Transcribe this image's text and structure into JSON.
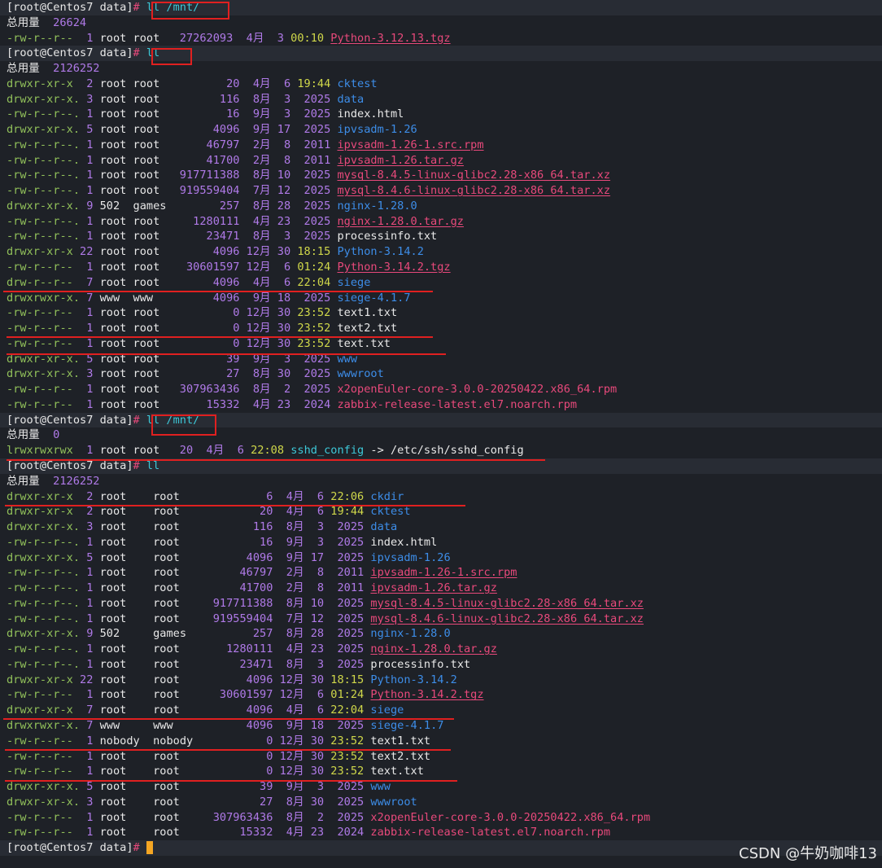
{
  "terminal": {
    "prompt": "[root@Centos7 data]",
    "hash": "#",
    "total_label": "总用量",
    "blocks": [
      {
        "cmd": "ll /mnt/",
        "total": "26624",
        "rows": [
          {
            "perm": "-rw-r--r--",
            "links": "1",
            "owner": "root",
            "group": "root",
            "size": "27262093",
            "month": "4月",
            "day": "3",
            "time": "00:10",
            "name": "Python-3.12.13.tgz",
            "type": "arch"
          }
        ]
      },
      {
        "cmd": "ll",
        "total": "2126252",
        "rows": [
          {
            "perm": "drwxr-xr-x",
            "links": "2",
            "owner": "root",
            "group": "root",
            "size": "20",
            "month": "4月",
            "day": "6",
            "time": "19:44",
            "name": "cktest",
            "type": "dir"
          },
          {
            "perm": "drwxr-xr-x.",
            "links": "3",
            "owner": "root",
            "group": "root",
            "size": "116",
            "month": "8月",
            "day": "3",
            "time": "2025",
            "name": "data",
            "type": "dir"
          },
          {
            "perm": "-rw-r--r--.",
            "links": "1",
            "owner": "root",
            "group": "root",
            "size": "16",
            "month": "9月",
            "day": "3",
            "time": "2025",
            "name": "index.html",
            "type": "file"
          },
          {
            "perm": "drwxr-xr-x.",
            "links": "5",
            "owner": "root",
            "group": "root",
            "size": "4096",
            "month": "9月",
            "day": "17",
            "time": "2025",
            "name": "ipvsadm-1.26",
            "type": "dir"
          },
          {
            "perm": "-rw-r--r--.",
            "links": "1",
            "owner": "root",
            "group": "root",
            "size": "46797",
            "month": "2月",
            "day": "8",
            "time": "2011",
            "name": "ipvsadm-1.26-1.src.rpm",
            "type": "rpm"
          },
          {
            "perm": "-rw-r--r--.",
            "links": "1",
            "owner": "root",
            "group": "root",
            "size": "41700",
            "month": "2月",
            "day": "8",
            "time": "2011",
            "name": "ipvsadm-1.26.tar.gz",
            "type": "arch"
          },
          {
            "perm": "-rw-r--r--.",
            "links": "1",
            "owner": "root",
            "group": "root",
            "size": "917711388",
            "month": "8月",
            "day": "10",
            "time": "2025",
            "name": "mysql-8.4.5-linux-glibc2.28-x86_64.tar.xz",
            "type": "arch"
          },
          {
            "perm": "-rw-r--r--.",
            "links": "1",
            "owner": "root",
            "group": "root",
            "size": "919559404",
            "month": "7月",
            "day": "12",
            "time": "2025",
            "name": "mysql-8.4.6-linux-glibc2.28-x86_64.tar.xz",
            "type": "arch"
          },
          {
            "perm": "drwxr-xr-x.",
            "links": "9",
            "owner": "502",
            "group": "games",
            "size": "257",
            "month": "8月",
            "day": "28",
            "time": "2025",
            "name": "nginx-1.28.0",
            "type": "dir"
          },
          {
            "perm": "-rw-r--r--.",
            "links": "1",
            "owner": "root",
            "group": "root",
            "size": "1280111",
            "month": "4月",
            "day": "23",
            "time": "2025",
            "name": "nginx-1.28.0.tar.gz",
            "type": "arch"
          },
          {
            "perm": "-rw-r--r--.",
            "links": "1",
            "owner": "root",
            "group": "root",
            "size": "23471",
            "month": "8月",
            "day": "3",
            "time": "2025",
            "name": "processinfo.txt",
            "type": "file"
          },
          {
            "perm": "drwxr-xr-x",
            "links": "22",
            "owner": "root",
            "group": "root",
            "size": "4096",
            "month": "12月",
            "day": "30",
            "time": "18:15",
            "name": "Python-3.14.2",
            "type": "dir"
          },
          {
            "perm": "-rw-r--r--",
            "links": "1",
            "owner": "root",
            "group": "root",
            "size": "30601597",
            "month": "12月",
            "day": "6",
            "time": "01:24",
            "name": "Python-3.14.2.tgz",
            "type": "arch"
          },
          {
            "perm": "drw-r--r--",
            "links": "7",
            "owner": "root",
            "group": "root",
            "size": "4096",
            "month": "4月",
            "day": "6",
            "time": "22:04",
            "name": "siege",
            "type": "dir"
          },
          {
            "perm": "drwxrwxr-x.",
            "links": "7",
            "owner": "www",
            "group": "www",
            "size": "4096",
            "month": "9月",
            "day": "18",
            "time": "2025",
            "name": "siege-4.1.7",
            "type": "dir"
          },
          {
            "perm": "-rw-r--r--",
            "links": "1",
            "owner": "root",
            "group": "root",
            "size": "0",
            "month": "12月",
            "day": "30",
            "time": "23:52",
            "name": "text1.txt",
            "type": "file"
          },
          {
            "perm": "-rw-r--r--",
            "links": "1",
            "owner": "root",
            "group": "root",
            "size": "0",
            "month": "12月",
            "day": "30",
            "time": "23:52",
            "name": "text2.txt",
            "type": "file"
          },
          {
            "perm": "-rw-r--r--",
            "links": "1",
            "owner": "root",
            "group": "root",
            "size": "0",
            "month": "12月",
            "day": "30",
            "time": "23:52",
            "name": "text.txt",
            "type": "file"
          },
          {
            "perm": "drwxr-xr-x.",
            "links": "5",
            "owner": "root",
            "group": "root",
            "size": "39",
            "month": "9月",
            "day": "3",
            "time": "2025",
            "name": "www",
            "type": "dir"
          },
          {
            "perm": "drwxr-xr-x.",
            "links": "3",
            "owner": "root",
            "group": "root",
            "size": "27",
            "month": "8月",
            "day": "30",
            "time": "2025",
            "name": "wwwroot",
            "type": "dir"
          },
          {
            "perm": "-rw-r--r--",
            "links": "1",
            "owner": "root",
            "group": "root",
            "size": "307963436",
            "month": "8月",
            "day": "2",
            "time": "2025",
            "name": "x2openEuler-core-3.0.0-20250422.x86_64.rpm",
            "type": "rpm"
          },
          {
            "perm": "-rw-r--r--",
            "links": "1",
            "owner": "root",
            "group": "root",
            "size": "15332",
            "month": "4月",
            "day": "23",
            "time": "2024",
            "name": "zabbix-release-latest.el7.noarch.rpm",
            "type": "rpm"
          }
        ]
      },
      {
        "cmd": "ll /mnt/",
        "total": "0",
        "rows": [
          {
            "perm": "lrwxrwxrwx",
            "links": "1",
            "owner": "root",
            "group": "root",
            "size": "20",
            "month": "4月",
            "day": "6",
            "time": "22:08",
            "name": "sshd_config",
            "type": "link",
            "target": "/etc/ssh/sshd_config"
          }
        ]
      },
      {
        "cmd": "ll",
        "total": "2126252",
        "rows": [
          {
            "perm": "drwxr-xr-x",
            "links": "2",
            "owner": "root",
            "group": "root",
            "size": "6",
            "month": "4月",
            "day": "6",
            "time": "22:06",
            "name": "ckdir",
            "type": "dir"
          },
          {
            "perm": "drwxr-xr-x",
            "links": "2",
            "owner": "root",
            "group": "root",
            "size": "20",
            "month": "4月",
            "day": "6",
            "time": "19:44",
            "name": "cktest",
            "type": "dir"
          },
          {
            "perm": "drwxr-xr-x.",
            "links": "3",
            "owner": "root",
            "group": "root",
            "size": "116",
            "month": "8月",
            "day": "3",
            "time": "2025",
            "name": "data",
            "type": "dir"
          },
          {
            "perm": "-rw-r--r--.",
            "links": "1",
            "owner": "root",
            "group": "root",
            "size": "16",
            "month": "9月",
            "day": "3",
            "time": "2025",
            "name": "index.html",
            "type": "file"
          },
          {
            "perm": "drwxr-xr-x.",
            "links": "5",
            "owner": "root",
            "group": "root",
            "size": "4096",
            "month": "9月",
            "day": "17",
            "time": "2025",
            "name": "ipvsadm-1.26",
            "type": "dir"
          },
          {
            "perm": "-rw-r--r--.",
            "links": "1",
            "owner": "root",
            "group": "root",
            "size": "46797",
            "month": "2月",
            "day": "8",
            "time": "2011",
            "name": "ipvsadm-1.26-1.src.rpm",
            "type": "rpm"
          },
          {
            "perm": "-rw-r--r--.",
            "links": "1",
            "owner": "root",
            "group": "root",
            "size": "41700",
            "month": "2月",
            "day": "8",
            "time": "2011",
            "name": "ipvsadm-1.26.tar.gz",
            "type": "arch"
          },
          {
            "perm": "-rw-r--r--.",
            "links": "1",
            "owner": "root",
            "group": "root",
            "size": "917711388",
            "month": "8月",
            "day": "10",
            "time": "2025",
            "name": "mysql-8.4.5-linux-glibc2.28-x86_64.tar.xz",
            "type": "arch"
          },
          {
            "perm": "-rw-r--r--.",
            "links": "1",
            "owner": "root",
            "group": "root",
            "size": "919559404",
            "month": "7月",
            "day": "12",
            "time": "2025",
            "name": "mysql-8.4.6-linux-glibc2.28-x86_64.tar.xz",
            "type": "arch"
          },
          {
            "perm": "drwxr-xr-x.",
            "links": "9",
            "owner": "502",
            "group": "games",
            "size": "257",
            "month": "8月",
            "day": "28",
            "time": "2025",
            "name": "nginx-1.28.0",
            "type": "dir"
          },
          {
            "perm": "-rw-r--r--.",
            "links": "1",
            "owner": "root",
            "group": "root",
            "size": "1280111",
            "month": "4月",
            "day": "23",
            "time": "2025",
            "name": "nginx-1.28.0.tar.gz",
            "type": "arch"
          },
          {
            "perm": "-rw-r--r--.",
            "links": "1",
            "owner": "root",
            "group": "root",
            "size": "23471",
            "month": "8月",
            "day": "3",
            "time": "2025",
            "name": "processinfo.txt",
            "type": "file"
          },
          {
            "perm": "drwxr-xr-x",
            "links": "22",
            "owner": "root",
            "group": "root",
            "size": "4096",
            "month": "12月",
            "day": "30",
            "time": "18:15",
            "name": "Python-3.14.2",
            "type": "dir"
          },
          {
            "perm": "-rw-r--r--",
            "links": "1",
            "owner": "root",
            "group": "root",
            "size": "30601597",
            "month": "12月",
            "day": "6",
            "time": "01:24",
            "name": "Python-3.14.2.tgz",
            "type": "arch"
          },
          {
            "perm": "drwxr-xr-x",
            "links": "7",
            "owner": "root",
            "group": "root",
            "size": "4096",
            "month": "4月",
            "day": "6",
            "time": "22:04",
            "name": "siege",
            "type": "dir"
          },
          {
            "perm": "drwxrwxr-x.",
            "links": "7",
            "owner": "www",
            "group": "www",
            "size": "4096",
            "month": "9月",
            "day": "18",
            "time": "2025",
            "name": "siege-4.1.7",
            "type": "dir"
          },
          {
            "perm": "-rw-r--r--",
            "links": "1",
            "owner": "nobody",
            "group": "nobody",
            "size": "0",
            "month": "12月",
            "day": "30",
            "time": "23:52",
            "name": "text1.txt",
            "type": "file"
          },
          {
            "perm": "-rw-r--r--",
            "links": "1",
            "owner": "root",
            "group": "root",
            "size": "0",
            "month": "12月",
            "day": "30",
            "time": "23:52",
            "name": "text2.txt",
            "type": "file"
          },
          {
            "perm": "-rw-r--r--",
            "links": "1",
            "owner": "root",
            "group": "root",
            "size": "0",
            "month": "12月",
            "day": "30",
            "time": "23:52",
            "name": "text.txt",
            "type": "file"
          },
          {
            "perm": "drwxr-xr-x.",
            "links": "5",
            "owner": "root",
            "group": "root",
            "size": "39",
            "month": "9月",
            "day": "3",
            "time": "2025",
            "name": "www",
            "type": "dir"
          },
          {
            "perm": "drwxr-xr-x.",
            "links": "3",
            "owner": "root",
            "group": "root",
            "size": "27",
            "month": "8月",
            "day": "30",
            "time": "2025",
            "name": "wwwroot",
            "type": "dir"
          },
          {
            "perm": "-rw-r--r--",
            "links": "1",
            "owner": "root",
            "group": "root",
            "size": "307963436",
            "month": "8月",
            "day": "2",
            "time": "2025",
            "name": "x2openEuler-core-3.0.0-20250422.x86_64.rpm",
            "type": "rpm"
          },
          {
            "perm": "-rw-r--r--",
            "links": "1",
            "owner": "root",
            "group": "root",
            "size": "15332",
            "month": "4月",
            "day": "23",
            "time": "2024",
            "name": "zabbix-release-latest.el7.noarch.rpm",
            "type": "rpm"
          }
        ]
      }
    ],
    "final_prompt": true
  },
  "watermark": "CSDN @牛奶咖啡13",
  "colors": {
    "background": "#1e2127",
    "permissions": "#91c05a",
    "numbers": "#b07ae8",
    "time": "#d0d84a",
    "directory": "#3d8de8",
    "archive": "#e8497b",
    "symlink": "#3dc8d8",
    "annotation": "#e02020",
    "cursor": "#f5a623"
  }
}
